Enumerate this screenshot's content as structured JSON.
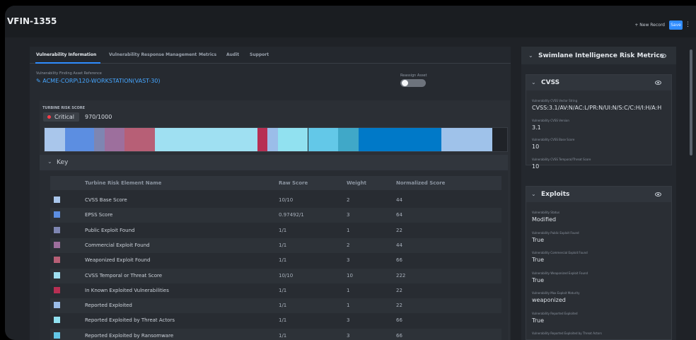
{
  "header": {
    "record_id": "VFIN-1355",
    "new_record": "+ New Record",
    "save": "Save",
    "more": "⋮"
  },
  "tabs": [
    {
      "label": "Vulnerability Information"
    },
    {
      "label": "Vulnerability Response Management"
    },
    {
      "label": "Metrics"
    },
    {
      "label": "Audit"
    },
    {
      "label": "Support"
    }
  ],
  "asset": {
    "label": "Vulnerability Finding Asset Reference",
    "value": "✎ ACME-CORP\\120-WORKSTATION(VAST-30)",
    "reassign_label": "Reassign Asset"
  },
  "risk": {
    "label": "TURBINE RISK SCORE",
    "severity": "Critical",
    "score": "970/1000",
    "severity_color": "#ff3d48"
  },
  "key": {
    "title": "Key",
    "columns": [
      "Turbine Risk Element Name",
      "Raw Score",
      "Weight",
      "Normalized Score"
    ],
    "rows": [
      {
        "name": "CVSS Base Score",
        "raw": "10/10",
        "weight": "2",
        "normalized": "44",
        "color": "#a9c6eb"
      },
      {
        "name": "EPSS Score",
        "raw": "0.97492/1",
        "weight": "3",
        "normalized": "64",
        "color": "#5c8ee1"
      },
      {
        "name": "Public Exploit Found",
        "raw": "1/1",
        "weight": "1",
        "normalized": "22",
        "color": "#7e86b2"
      },
      {
        "name": "Commercial Exploit Found",
        "raw": "1/1",
        "weight": "2",
        "normalized": "44",
        "color": "#9d6f9d"
      },
      {
        "name": "Weaponized Exploit Found",
        "raw": "1/1",
        "weight": "3",
        "normalized": "66",
        "color": "#b75f76"
      },
      {
        "name": "CVSS Temporal or Threat Score",
        "raw": "10/10",
        "weight": "10",
        "normalized": "222",
        "color": "#9fe0f2"
      },
      {
        "name": "In Known Exploited Vulnerabilities",
        "raw": "1/1",
        "weight": "1",
        "normalized": "22",
        "color": "#b72f53"
      },
      {
        "name": "Reported Exploited",
        "raw": "1/1",
        "weight": "1",
        "normalized": "22",
        "color": "#9bbde9"
      },
      {
        "name": "Reported Exploited by Threat Actors",
        "raw": "1/1",
        "weight": "3",
        "normalized": "66",
        "color": "#91e1f0"
      },
      {
        "name": "Reported Exploited by Ransomware",
        "raw": "1/1",
        "weight": "3",
        "normalized": "66",
        "color": "#63c8e8"
      }
    ]
  },
  "risk_bar_segments": [
    {
      "value": 44,
      "color": "#a9c6eb"
    },
    {
      "value": 64,
      "color": "#5c8ee1"
    },
    {
      "value": 22,
      "color": "#7e86b2"
    },
    {
      "value": 44,
      "color": "#9d6f9d"
    },
    {
      "value": 66,
      "color": "#b75f76"
    },
    {
      "value": 222,
      "color": "#9fe0f2"
    },
    {
      "value": 22,
      "color": "#b72f53"
    },
    {
      "value": 22,
      "color": "#9bbde9"
    },
    {
      "value": 66,
      "color": "#91e1f0"
    },
    {
      "value": 66,
      "color": "#63c8e8"
    },
    {
      "value": 44,
      "color": "#40a8c8"
    },
    {
      "value": 180,
      "color": "#0079c8"
    },
    {
      "value": 110,
      "color": "#9fc2ea"
    }
  ],
  "sidebar": {
    "title": "Swimlane Intelligence Risk Metrics",
    "cvss": {
      "title": "CVSS",
      "fields": [
        {
          "label": "Vulnerability CVSS Vector String",
          "value": "CVSS:3.1/AV:N/AC:L/PR:N/UI:N/S:C/C:H/I:H/A:H"
        },
        {
          "label": "Vulnerability CVSS Version",
          "value": "3.1"
        },
        {
          "label": "Vulnerability CVSS Base Score",
          "value": "10"
        },
        {
          "label": "Vulnerability CVSS Temporal/Threat Score",
          "value": "10"
        }
      ]
    },
    "exploits": {
      "title": "Exploits",
      "fields": [
        {
          "label": "Vulnerability Status",
          "value": "Modified"
        },
        {
          "label": "Vulnerability Public Exploit Found",
          "value": "True"
        },
        {
          "label": "Vulnerability Commercial Exploit Found",
          "value": "True"
        },
        {
          "label": "Vulnerability Weaponized Exploit Found",
          "value": "True"
        },
        {
          "label": "Vulnerability Max Exploit Maturity",
          "value": "weaponized"
        },
        {
          "label": "Vulnerability Reported Exploited",
          "value": "True"
        },
        {
          "label": "Vulnerability Reported Exploited by Threat Actors",
          "value": ""
        }
      ]
    }
  }
}
